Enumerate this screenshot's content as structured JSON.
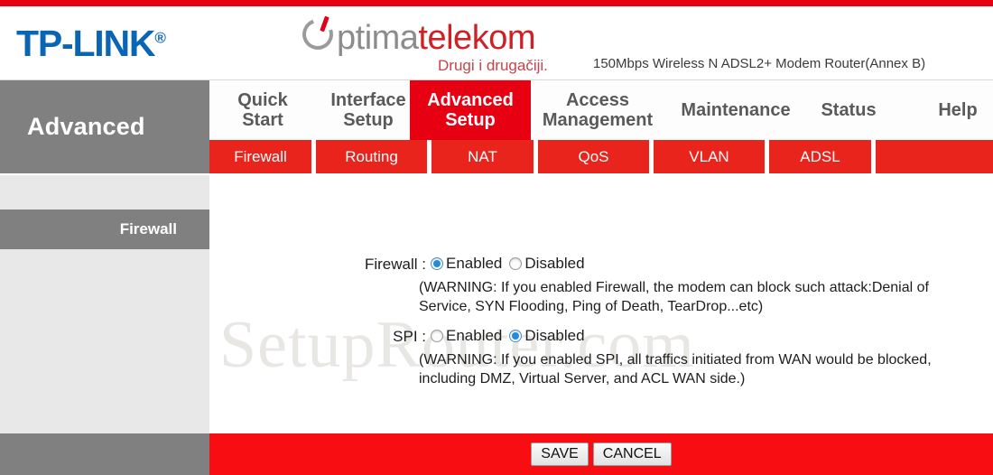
{
  "brand": {
    "tplink": "TP-LINK",
    "tplink_reg": "®",
    "optima_gray": "ptima",
    "optima_red": "telekom",
    "optima_tagline": "Drugi i drugačiji.",
    "model": "150Mbps Wireless N ADSL2+ Modem Router(Annex B)",
    "colors": {
      "tplink_blue": "#0a66b5",
      "accent_red": "#e60012",
      "optima_gray": "#8c8c8c",
      "optima_red": "#cf2026",
      "nav_gray": "#808080"
    }
  },
  "nav": {
    "page_title": "Advanced",
    "tabs": [
      {
        "label": "Quick Start",
        "active": false
      },
      {
        "label": "Interface Setup",
        "active": false
      },
      {
        "label": "Advanced Setup",
        "active": true
      },
      {
        "label": "Access Management",
        "active": false
      },
      {
        "label": "Maintenance",
        "active": false
      },
      {
        "label": "Status",
        "active": false
      },
      {
        "label": "Help",
        "active": false
      }
    ],
    "subtabs": [
      {
        "label": "Firewall",
        "active": true
      },
      {
        "label": "Routing",
        "active": false
      },
      {
        "label": "NAT",
        "active": false
      },
      {
        "label": "QoS",
        "active": false
      },
      {
        "label": "VLAN",
        "active": false
      },
      {
        "label": "ADSL",
        "active": false
      }
    ]
  },
  "section": {
    "heading": "Firewall"
  },
  "form": {
    "firewall": {
      "label": "Firewall :",
      "options": [
        "Enabled",
        "Disabled"
      ],
      "selected": "Enabled",
      "warning": "(WARNING: If you enabled Firewall, the modem can block such attack:Denial of Service, SYN Flooding, Ping of Death, TearDrop...etc)"
    },
    "spi": {
      "label": "SPI :",
      "options": [
        "Enabled",
        "Disabled"
      ],
      "selected": "Disabled",
      "warning": "(WARNING: If you enabled SPI, all traffics initiated from WAN would be blocked, including DMZ, Virtual Server, and ACL WAN side.)"
    }
  },
  "footer": {
    "save_label": "SAVE",
    "cancel_label": "CANCEL"
  },
  "watermark": "SetupRouter.com"
}
